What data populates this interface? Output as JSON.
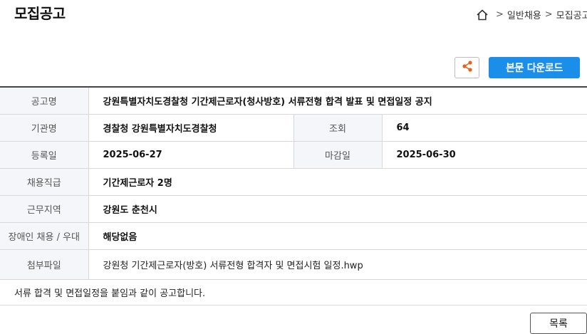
{
  "page": {
    "title": "모집공고"
  },
  "breadcrumb": {
    "home_icon": "home-icon",
    "items": [
      "일반채용",
      "모집공고"
    ],
    "separator": ">"
  },
  "toolbar": {
    "share_icon": "share-icon",
    "download_label": "본문 다운로드",
    "accent": "#1a8ee8"
  },
  "info": {
    "title_label": "공고명",
    "title_value": "강원특별자치도경찰청 기간제근로자(청사방호) 서류전형 합격 발표 및 면접일정 공지",
    "agency_label": "기관명",
    "agency_value": "경찰청 강원특별자치도경찰청",
    "views_label": "조회",
    "views_value": "64",
    "registered_label": "등록일",
    "registered_value": "2025-06-27",
    "deadline_label": "마감일",
    "deadline_value": "2025-06-30",
    "position_label": "채용직급",
    "position_value": "기간제근로자 2명",
    "location_label": "근무지역",
    "location_value": "강원도 춘천시",
    "disability_label": "장애인 채용 / 우대",
    "disability_value": "해당없음",
    "attachment_label": "첨부파일",
    "attachment_value": "강원청 기간제근로자(방호) 서류전형 합격자 및 면접시험 일정.hwp"
  },
  "body": {
    "notice": "서류 합격 및 면접일정을 붙임과 같이 공고합니다."
  },
  "footer": {
    "list_label": "목록"
  }
}
